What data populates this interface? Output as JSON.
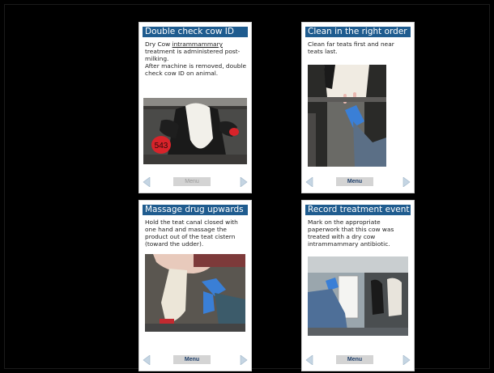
{
  "cards": [
    {
      "title": "Double check cow ID",
      "body_line1_prefix": "Dry Cow ",
      "body_line1_underlined": "intrammammary",
      "body_line1_suffix": " treatment is administered post-milking.",
      "body_line2": "After machine is removed, double check cow ID on animal.",
      "photo_tag": "543",
      "menu_label": "Menu",
      "menu_state": "disabled"
    },
    {
      "title": "Clean in the right order",
      "body": "Clean far teats first and near teats last.",
      "menu_label": "Menu",
      "menu_state": "enabled"
    },
    {
      "title": "Massage drug upwards",
      "body": "Hold the teat canal closed with one hand and massage the product out of the teat cistern (toward the udder).",
      "menu_label": "Menu",
      "menu_state": "enabled"
    },
    {
      "title": "Record treatment event",
      "body": "Mark on the appropriate paperwork that this cow was treated with a dry cow intrammammary antibiotic.",
      "menu_label": "Menu",
      "menu_state": "enabled"
    }
  ],
  "colors": {
    "title_bar": "#1f5c8f",
    "nav_arrow": "#c5d5e3",
    "glove": "#3a7fd6",
    "tag": "#d8232a"
  },
  "icons": [
    "chevron-left-icon",
    "chevron-right-icon"
  ]
}
